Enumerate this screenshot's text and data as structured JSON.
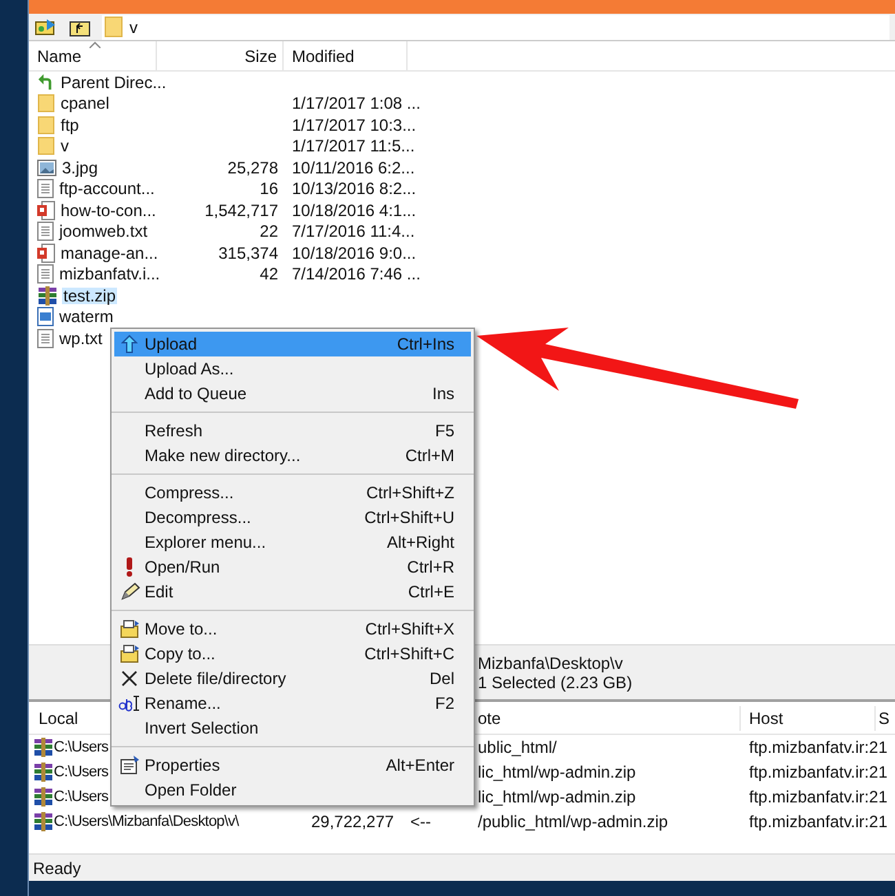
{
  "toolbar": {
    "path": "v"
  },
  "file_list": {
    "columns": [
      "Name",
      "Size",
      "Modified"
    ],
    "rows": [
      {
        "kind": "parent",
        "name": "Parent Direc...",
        "selected": false
      },
      {
        "kind": "folder",
        "name": "cpanel",
        "modified": "1/17/2017 1:08 ...",
        "selected": false
      },
      {
        "kind": "folder",
        "name": "ftp",
        "modified": "1/17/2017 10:3...",
        "selected": false
      },
      {
        "kind": "folder",
        "name": "v",
        "modified": "1/17/2017 11:5...",
        "selected": false
      },
      {
        "kind": "image",
        "name": "3.jpg",
        "size": "25,278",
        "modified": "10/11/2016 6:2...",
        "selected": false
      },
      {
        "kind": "text",
        "name": "ftp-account...",
        "size": "16",
        "modified": "10/13/2016 8:2...",
        "selected": false
      },
      {
        "kind": "pdf",
        "name": "how-to-con...",
        "size": "1,542,717",
        "modified": "10/18/2016 4:1...",
        "selected": false
      },
      {
        "kind": "text",
        "name": "joomweb.txt",
        "size": "22",
        "modified": "7/17/2016 11:4...",
        "selected": false
      },
      {
        "kind": "pdf",
        "name": "manage-an...",
        "size": "315,374",
        "modified": "10/18/2016 9:0...",
        "selected": false
      },
      {
        "kind": "text",
        "name": "mizbanfatv.i...",
        "size": "42",
        "modified": "7/14/2016 7:46 ...",
        "selected": false
      },
      {
        "kind": "archive",
        "name": "test.zip",
        "selected": true
      },
      {
        "kind": "bitmap",
        "name": "waterm",
        "selected": false
      },
      {
        "kind": "text",
        "name": "wp.txt",
        "selected": false
      }
    ]
  },
  "info_panel": {
    "path": "Mizbanfa\\Desktop\\v",
    "selection": "1 Selected (2.23 GB)"
  },
  "queue": {
    "columns": {
      "local": "Local",
      "remote": "ote",
      "host": "Host",
      "extra": "S"
    },
    "rows": [
      {
        "local": "C:\\Users",
        "remote": "ublic_html/",
        "host": "ftp.mizbanfatv.ir:21"
      },
      {
        "local": "C:\\Users",
        "remote": "lic_html/wp-admin.zip",
        "host": "ftp.mizbanfatv.ir:21"
      },
      {
        "local": "C:\\Users",
        "remote": "lic_html/wp-admin.zip",
        "host": "ftp.mizbanfatv.ir:21"
      },
      {
        "local": "C:\\Users\\Mizbanfa\\Desktop\\v\\",
        "size": "29,722,277",
        "direction": "<--",
        "remote": "/public_html/wp-admin.zip",
        "host": "ftp.mizbanfatv.ir:21"
      }
    ]
  },
  "context_menu": {
    "groups": [
      [
        {
          "kind": "upload",
          "label": "Upload",
          "shortcut": "Ctrl+Ins",
          "highlighted": true
        },
        {
          "kind": "plain",
          "label": "Upload As...",
          "highlighted": false
        },
        {
          "kind": "plain",
          "label": "Add to Queue",
          "shortcut": "Ins",
          "highlighted": false
        }
      ],
      [
        {
          "kind": "plain",
          "label": "Refresh",
          "shortcut": "F5",
          "highlighted": false
        },
        {
          "kind": "plain",
          "label": "Make new directory...",
          "shortcut": "Ctrl+M",
          "highlighted": false
        }
      ],
      [
        {
          "kind": "plain",
          "label": "Compress...",
          "shortcut": "Ctrl+Shift+Z",
          "highlighted": false
        },
        {
          "kind": "plain",
          "label": "Decompress...",
          "shortcut": "Ctrl+Shift+U",
          "highlighted": false
        },
        {
          "kind": "plain",
          "label": "Explorer menu...",
          "shortcut": "Alt+Right",
          "highlighted": false
        },
        {
          "kind": "run",
          "label": "Open/Run",
          "shortcut": "Ctrl+R",
          "highlighted": false
        },
        {
          "kind": "edit",
          "label": "Edit",
          "shortcut": "Ctrl+E",
          "highlighted": false
        }
      ],
      [
        {
          "kind": "move",
          "label": "Move to...",
          "shortcut": "Ctrl+Shift+X",
          "highlighted": false
        },
        {
          "kind": "copy",
          "label": "Copy to...",
          "shortcut": "Ctrl+Shift+C",
          "highlighted": false
        },
        {
          "kind": "delete",
          "label": "Delete file/directory",
          "shortcut": "Del",
          "highlighted": false
        },
        {
          "kind": "rename",
          "label": "Rename...",
          "shortcut": "F2",
          "highlighted": false
        },
        {
          "kind": "plain",
          "label": "Invert Selection",
          "highlighted": false
        }
      ],
      [
        {
          "kind": "properties",
          "label": "Properties",
          "shortcut": "Alt+Enter",
          "highlighted": false
        },
        {
          "kind": "plain",
          "label": "Open Folder",
          "highlighted": false
        }
      ]
    ]
  },
  "status_bar": {
    "text": "Ready"
  }
}
